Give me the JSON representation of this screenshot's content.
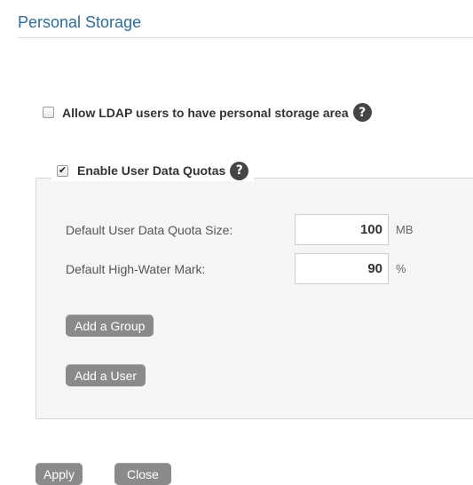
{
  "page": {
    "title": "Personal Storage"
  },
  "ldap": {
    "label": "Allow LDAP users to have personal storage area",
    "checked": false
  },
  "quotas": {
    "label": "Enable User Data Quotas",
    "checked": true,
    "default_size": {
      "label": "Default User Data Quota Size:",
      "value": "100",
      "unit": "MB"
    },
    "high_water": {
      "label": "Default High-Water Mark:",
      "value": "90",
      "unit": "%"
    },
    "add_group_label": "Add a Group",
    "add_user_label": "Add a User"
  },
  "actions": {
    "apply_label": "Apply",
    "close_label": "Close"
  },
  "icons": {
    "help": "help-icon",
    "checkmark": "checkmark-icon"
  },
  "colors": {
    "title": "#2f6d9a",
    "button": "#8a8a8a",
    "panel": "#f5f5f5"
  }
}
